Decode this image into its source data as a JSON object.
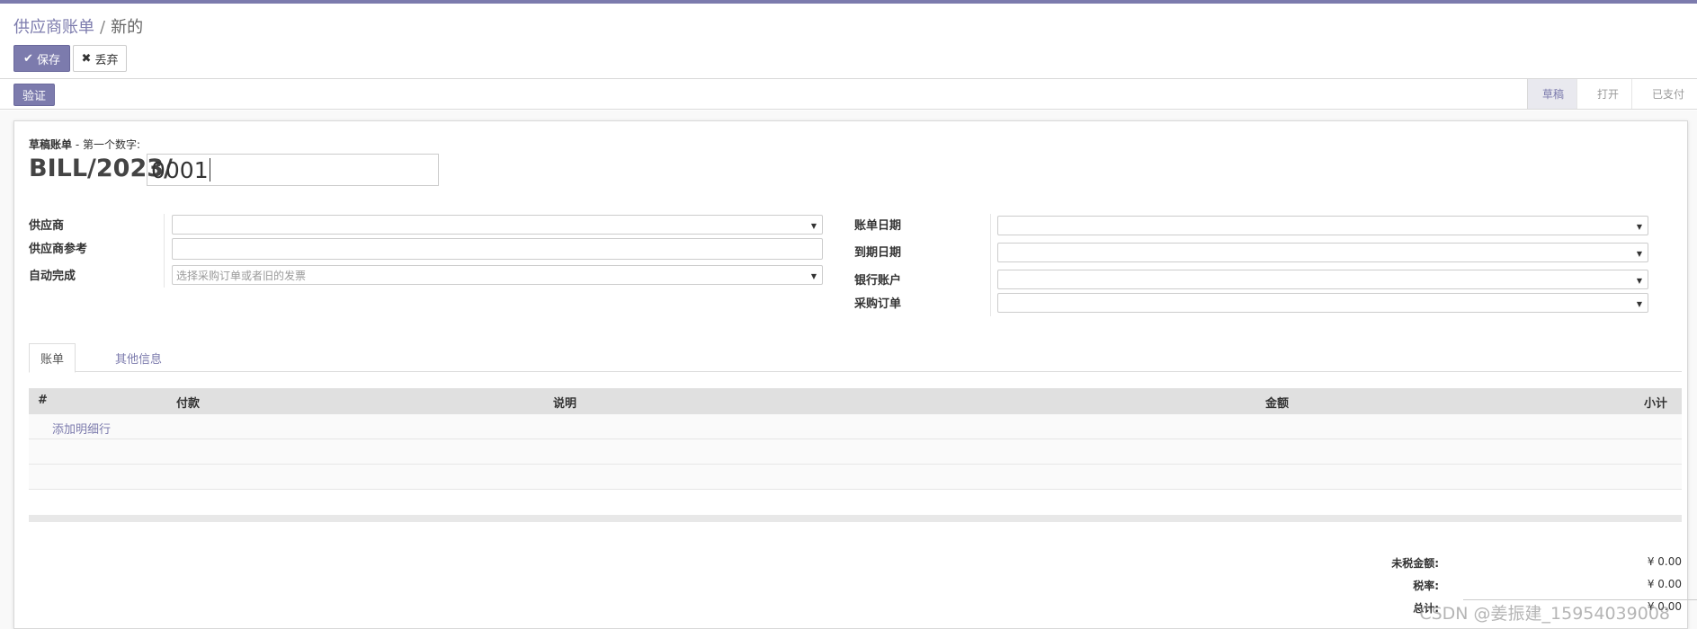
{
  "breadcrumb": {
    "parent": "供应商账单",
    "current": "新的"
  },
  "control_panel": {
    "save_label": "保存",
    "discard_label": "丢弃"
  },
  "statusbar": {
    "validate_label": "验证",
    "stages": [
      {
        "label": "草稿",
        "active": true
      },
      {
        "label": "打开",
        "active": false
      },
      {
        "label": "已支付",
        "active": false
      }
    ]
  },
  "header": {
    "draft_label": "草稿账单",
    "first_number_label": " - 第一个数字:",
    "bill_prefix": "BILL/2023/",
    "bill_number": "0001"
  },
  "left_fields": {
    "vendor_label": "供应商",
    "vendor_ref_label": "供应商参考",
    "autocomplete_label": "自动完成",
    "autocomplete_placeholder": "选择采购订单或者旧的发票"
  },
  "right_fields": {
    "bill_date_label": "账单日期",
    "due_date_label": "到期日期",
    "bank_account_label": "银行账户",
    "purchase_order_label": "采购订单"
  },
  "tabs": {
    "bill": "账单",
    "other_info": "其他信息"
  },
  "table": {
    "headers": {
      "num": "#",
      "payment": "付款",
      "description": "说明",
      "amount": "金额",
      "subtotal": "小计"
    },
    "add_line": "添加明细行"
  },
  "totals": {
    "untaxed_label": "未税金额:",
    "untaxed_value": "¥ 0.00",
    "tax_label": "税率:",
    "tax_value": "¥ 0.00",
    "total_label": "总计:",
    "total_value": "¥ 0.00"
  },
  "watermark": "CSDN @姜振建_15954039008",
  "colors": {
    "accent": "#7c7bad"
  }
}
